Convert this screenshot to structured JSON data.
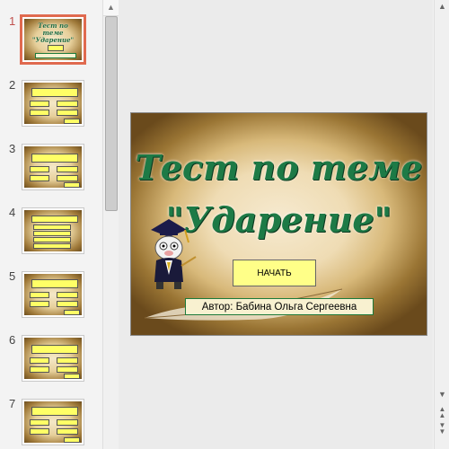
{
  "thumbnails": [
    {
      "number": "1",
      "active": true,
      "title": "Тест по теме \"Ударение\""
    },
    {
      "number": "2",
      "active": false
    },
    {
      "number": "3",
      "active": false
    },
    {
      "number": "4",
      "active": false
    },
    {
      "number": "5",
      "active": false
    },
    {
      "number": "6",
      "active": false
    },
    {
      "number": "7",
      "active": false
    }
  ],
  "slide": {
    "title_line1": "Тест по теме",
    "title_line2": "\"Ударение\"",
    "start_button": "НАЧАТЬ",
    "author": "Автор: Бабина Ольга Сергеевна"
  },
  "icons": {
    "scroll_up": "arrow-up-icon",
    "scroll_down": "arrow-down-icon",
    "prev_slide": "double-arrow-up-icon",
    "next_slide": "double-arrow-down-icon"
  },
  "colors": {
    "title_green": "#1d7a46",
    "active_thumb_border": "#e06a4f",
    "button_yellow": "#ffff88"
  }
}
